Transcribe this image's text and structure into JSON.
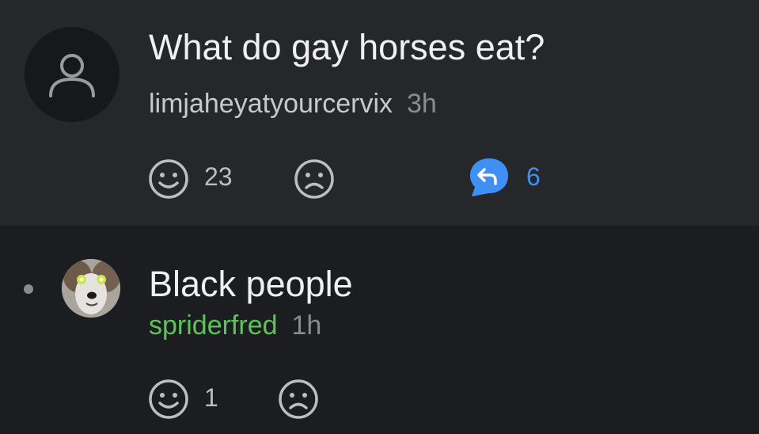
{
  "post": {
    "title": "What do gay horses eat?",
    "author": "limjaheyatyourcervix",
    "time": "3h",
    "likes": "23",
    "replies": "6",
    "avatar_icon": "user-outline-icon"
  },
  "reply": {
    "text": "Black people",
    "author": "spriderfred",
    "time": "1h",
    "likes": "1",
    "avatar_icon": "dog-photo-avatar"
  },
  "colors": {
    "post_bg": "#26272b",
    "reply_bg": "#1c1d21",
    "reply_accent": "#3f8ff5",
    "author_green": "#5cc458"
  }
}
